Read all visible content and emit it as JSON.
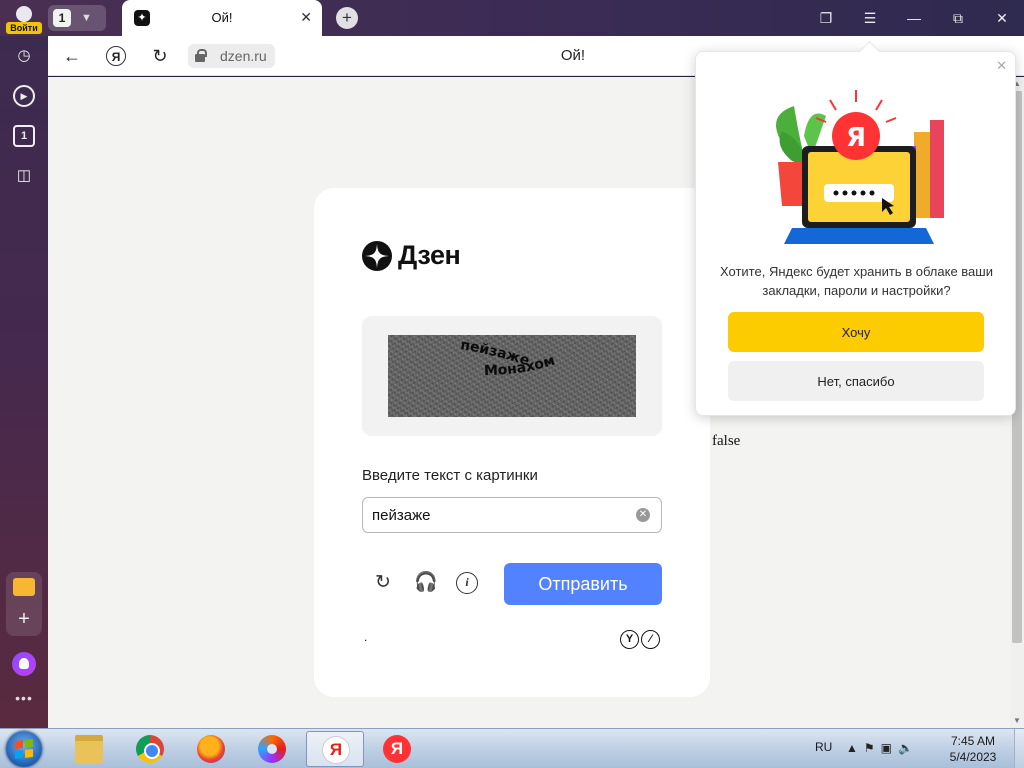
{
  "browser": {
    "profile_label": "Войти",
    "tab_count": "1",
    "active_tab_title": "Ой!",
    "sidebar_counter": "1",
    "address_domain": "dzen.ru",
    "page_title": "Ой!",
    "ya_button": "Я"
  },
  "captcha": {
    "brand_name": "Дзен",
    "distorted_word_1": "пейзаже",
    "distorted_word_2": "Монахом",
    "instruction": "Введите текст с картинки",
    "answer_value": "пейзаже",
    "submit_label": "Отправить",
    "footer_dot": ".",
    "accent_color": "#5282ff"
  },
  "stray_text": "false",
  "sync_popup": {
    "question": "Хотите, Яндекс будет хранить в облаке ваши закладки, пароли и настройки?",
    "yes_label": "Хочу",
    "no_label": "Нет, спасибо",
    "ya_letter": "Я",
    "yes_color": "#fccc00"
  },
  "taskbar": {
    "apps": [
      "file-explorer",
      "google-chrome",
      "firefox",
      "swirl-browser",
      "yandex-browser",
      "yandex"
    ],
    "language": "RU",
    "time": "7:45 AM",
    "date": "5/4/2023"
  }
}
